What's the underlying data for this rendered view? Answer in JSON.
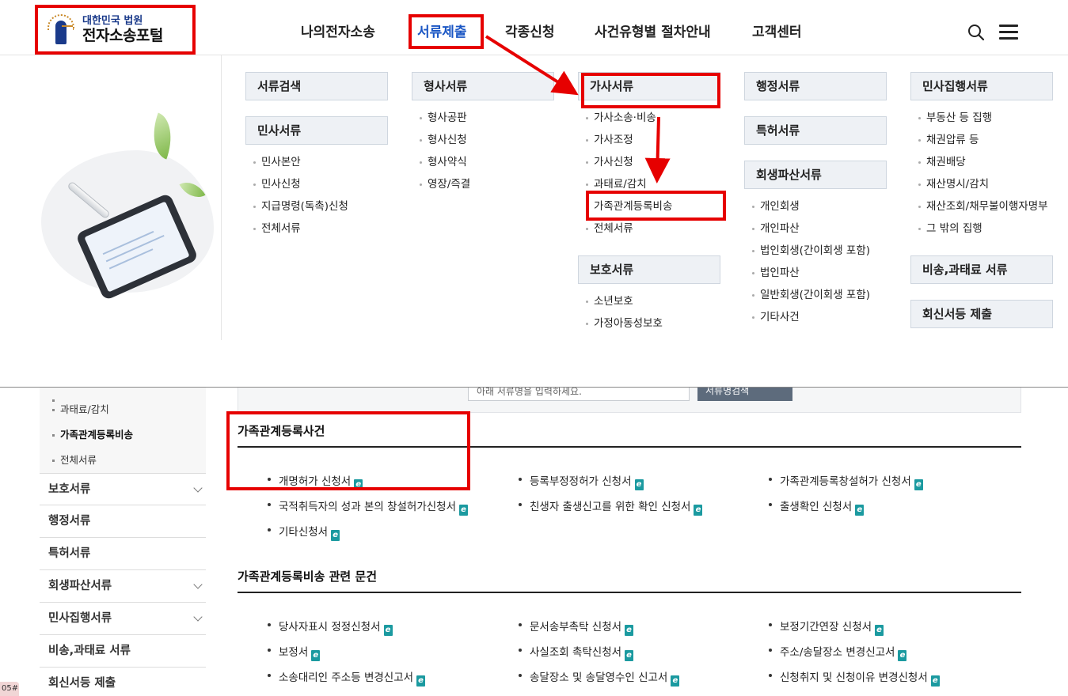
{
  "header": {
    "logo_line1": "대한민국 법원",
    "logo_line2": "전자소송포털",
    "nav": [
      "나의전자소송",
      "서류제출",
      "각종신청",
      "사건유형별 절차안내",
      "고객센터"
    ]
  },
  "mega_menu": {
    "col1": {
      "cat1": "서류검색",
      "cat2": "민사서류",
      "items": [
        "민사본안",
        "민사신청",
        "지급명령(독촉)신청",
        "전체서류"
      ]
    },
    "col2": {
      "cat1": "형사서류",
      "items": [
        "형사공판",
        "형사신청",
        "형사약식",
        "영장/즉결"
      ]
    },
    "col3": {
      "cat1": "가사서류",
      "items": [
        "가사소송·비송",
        "가사조정",
        "가사신청",
        "과태료/감치",
        "가족관계등록비송",
        "전체서류"
      ],
      "cat2": "보호서류",
      "items2": [
        "소년보호",
        "가정아동성보호"
      ]
    },
    "col4": {
      "cat1": "행정서류",
      "cat2": "특허서류",
      "cat3": "회생파산서류",
      "items": [
        "개인회생",
        "개인파산",
        "법인회생(간이회생 포함)",
        "법인파산",
        "일반회생(간이회생 포함)",
        "기타사건"
      ]
    },
    "col5": {
      "cat1": "민사집행서류",
      "items": [
        "부동산 등 집행",
        "채권압류 등",
        "채권배당",
        "재산명시/감치",
        "재산조회/채무불이행자명부",
        "그 밖의 집행"
      ],
      "cat2": "비송,과태료 서류",
      "cat3": "회신서등 제출"
    }
  },
  "search": {
    "placeholder": "아래 서류명을 입력하세요.",
    "button": "서류명검색"
  },
  "lnb": {
    "sub_items": [
      "과태료/감치",
      "가족관계등록비송",
      "전체서류"
    ],
    "items": [
      "보호서류",
      "행정서류",
      "특허서류",
      "회생파산서류",
      "민사집행서류",
      "비송,과태료 서류",
      "회신서등 제출"
    ]
  },
  "section1": {
    "title": "가족관계등록사건",
    "docs": [
      "개명허가 신청서",
      "등록부정정허가 신청서",
      "가족관계등록창설허가 신청서",
      "국적취득자의 성과 본의 창설허가신청서",
      "친생자 출생신고를 위한 확인 신청서",
      "출생확인 신청서",
      "기타신청서"
    ]
  },
  "section2": {
    "title": "가족관계등록비송 관련 문건",
    "docs": [
      "당사자표시 정정신청서",
      "문서송부촉탁 신청서",
      "보정기간연장 신청서",
      "보정서",
      "사실조회 촉탁신청서",
      "주소/송달장소 변경신고서",
      "소송대리인 주소등 변경신고서",
      "송달장소 및 송달영수인 신고서",
      "신청취지 및 신청이유 변경신청서"
    ]
  },
  "doc_icon": "e",
  "corner_tag": "05#"
}
